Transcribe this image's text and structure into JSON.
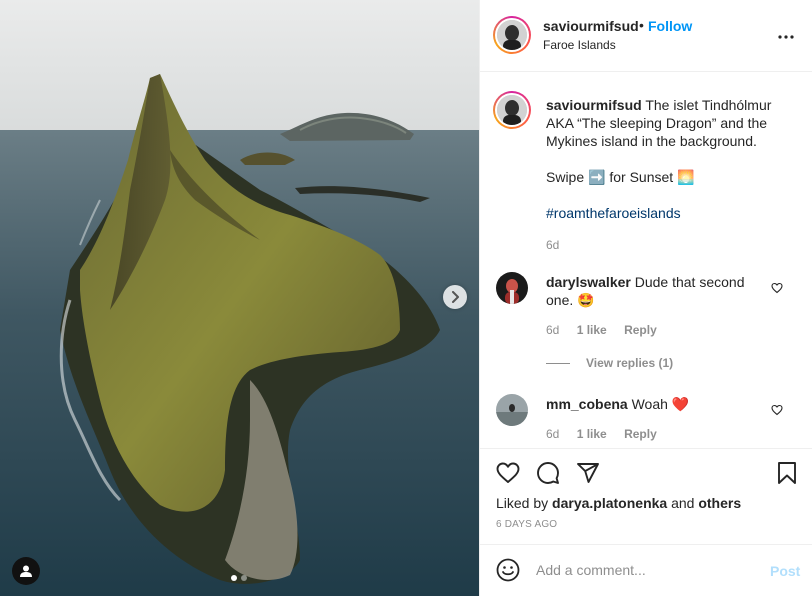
{
  "post": {
    "username": "saviourmifsud",
    "separator": "•",
    "follow_label": "Follow",
    "location": "Faroe Islands",
    "caption_line1": "The islet Tindhólmur AKA “The sleeping Dragon” and the Mykines island in the background.",
    "caption_line2_prefix": "Swipe",
    "caption_line2_arrow": "➡️",
    "caption_line2_mid": "for Sunset",
    "caption_line2_emoji": "🌅",
    "hashtag": "#roamthefaroeislands",
    "caption_time": "6d",
    "image_index": 1,
    "image_count": 2
  },
  "comments": [
    {
      "username": "darylswalker",
      "text": "Dude that second one.",
      "emoji": "🤩",
      "time": "6d",
      "likes": "1 like",
      "reply": "Reply",
      "view_replies": "View replies (1)"
    },
    {
      "username": "mm_cobena",
      "text": "Woah",
      "emoji": "❤️",
      "time": "6d",
      "likes": "1 like",
      "reply": "Reply"
    }
  ],
  "actions": {
    "liked_prefix": "Liked by",
    "liked_user": "darya.platonenka",
    "liked_and": "and",
    "liked_others": "others",
    "posted_ago": "6 DAYS AGO"
  },
  "composer": {
    "placeholder": "Add a comment...",
    "post_label": "Post"
  },
  "colors": {
    "accent_blue": "#0095f6",
    "post_disabled": "#b2dffc",
    "hashtag": "#00376b",
    "muted": "#8e8e8e",
    "like_heart": "#ed4956"
  },
  "icons": [
    "chevron-right-icon",
    "user-tag-icon",
    "more-icon",
    "heart-icon",
    "comment-icon",
    "share-icon",
    "bookmark-icon",
    "emoji-icon"
  ]
}
